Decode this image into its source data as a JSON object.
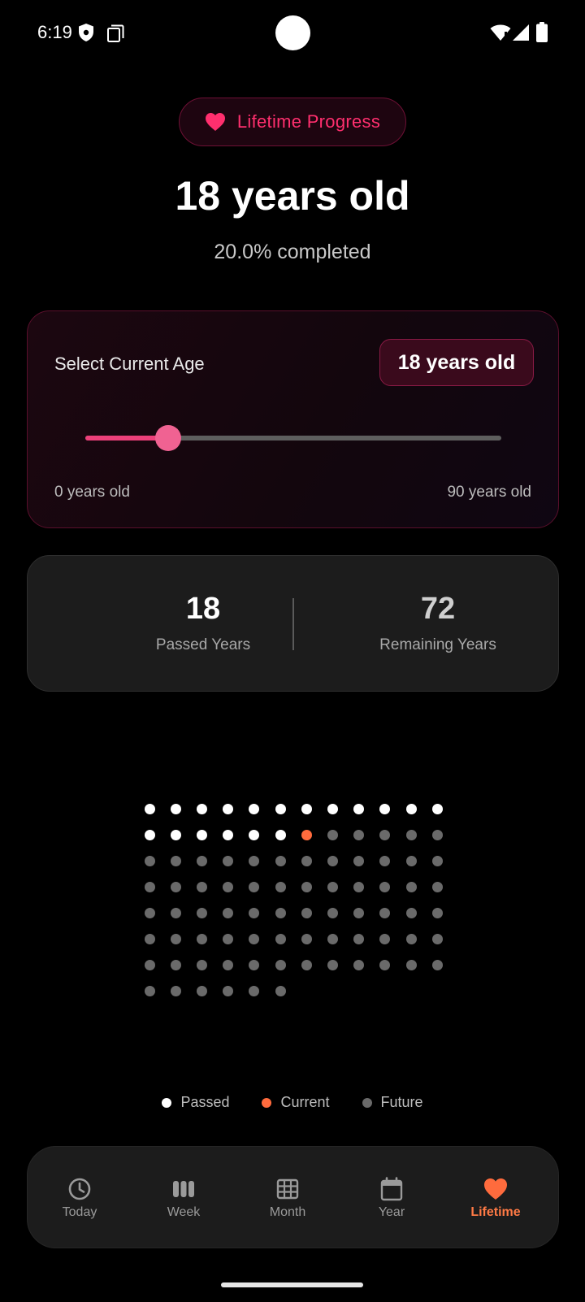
{
  "status_bar": {
    "time": "6:19"
  },
  "header": {
    "pill_label": "Lifetime Progress",
    "title": "18 years old",
    "subtitle": "20.0% completed"
  },
  "age_selector": {
    "label": "Select Current Age",
    "chip": "18 years old",
    "value": 18,
    "min": 0,
    "max": 90,
    "min_label": "0 years old",
    "max_label": "90 years old"
  },
  "stats": {
    "passed_value": "18",
    "passed_label": "Passed Years",
    "remaining_value": "72",
    "remaining_label": "Remaining Years"
  },
  "grid": {
    "total": 90,
    "passed": 18,
    "current_index": 18
  },
  "legend": {
    "passed": "Passed",
    "current": "Current",
    "future": "Future"
  },
  "nav": {
    "items": [
      {
        "label": "Today",
        "icon": "clock-icon"
      },
      {
        "label": "Week",
        "icon": "week-bars-icon"
      },
      {
        "label": "Month",
        "icon": "grid-icon"
      },
      {
        "label": "Year",
        "icon": "calendar-icon"
      },
      {
        "label": "Lifetime",
        "icon": "heart-icon"
      }
    ],
    "active": "Lifetime"
  },
  "colors": {
    "accent_pink": "#ff2f6e",
    "slider_pink": "#ec407a",
    "current_orange": "#ff6b3d",
    "nav_active": "#ff7a45",
    "future_gray": "#6a6a6a"
  }
}
